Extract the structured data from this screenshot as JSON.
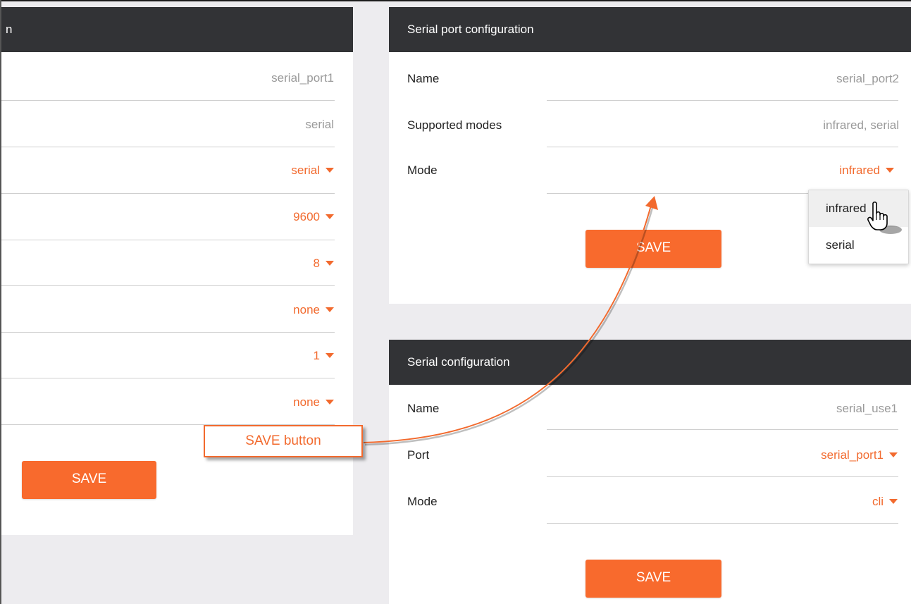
{
  "left_panel": {
    "header_fragment": "n",
    "values": [
      {
        "text": "serial_port1",
        "kind": "static"
      },
      {
        "text": "serial",
        "kind": "static"
      },
      {
        "text": "serial",
        "kind": "select"
      },
      {
        "text": "9600",
        "kind": "select"
      },
      {
        "text": "8",
        "kind": "select"
      },
      {
        "text": "none",
        "kind": "select"
      },
      {
        "text": "1",
        "kind": "select"
      },
      {
        "text": "none",
        "kind": "select"
      }
    ],
    "save_label": "SAVE"
  },
  "serial_port_panel": {
    "title": "Serial port configuration",
    "name_label": "Name",
    "name_value": "serial_port2",
    "supported_modes_label": "Supported modes",
    "supported_modes_value": "infrared, serial",
    "mode_label": "Mode",
    "mode_value": "infrared",
    "save_label": "SAVE",
    "mode_dropdown": {
      "options": [
        "infrared",
        "serial"
      ],
      "hovered": "infrared"
    }
  },
  "serial_config_panel": {
    "title": "Serial configuration",
    "name_label": "Name",
    "name_value": "serial_use1",
    "port_label": "Port",
    "port_value": "serial_port1",
    "mode_label": "Mode",
    "mode_value": "cli",
    "save_label": "SAVE"
  },
  "annotation": {
    "callout_text": "SAVE button"
  },
  "colors": {
    "accent": "#f26a2e",
    "button": "#f86a2d",
    "header_bg": "#323336",
    "page_bg": "#edecef"
  },
  "icons": [
    "caret-down-icon",
    "hand-pointer-icon",
    "curved-arrow-icon"
  ]
}
